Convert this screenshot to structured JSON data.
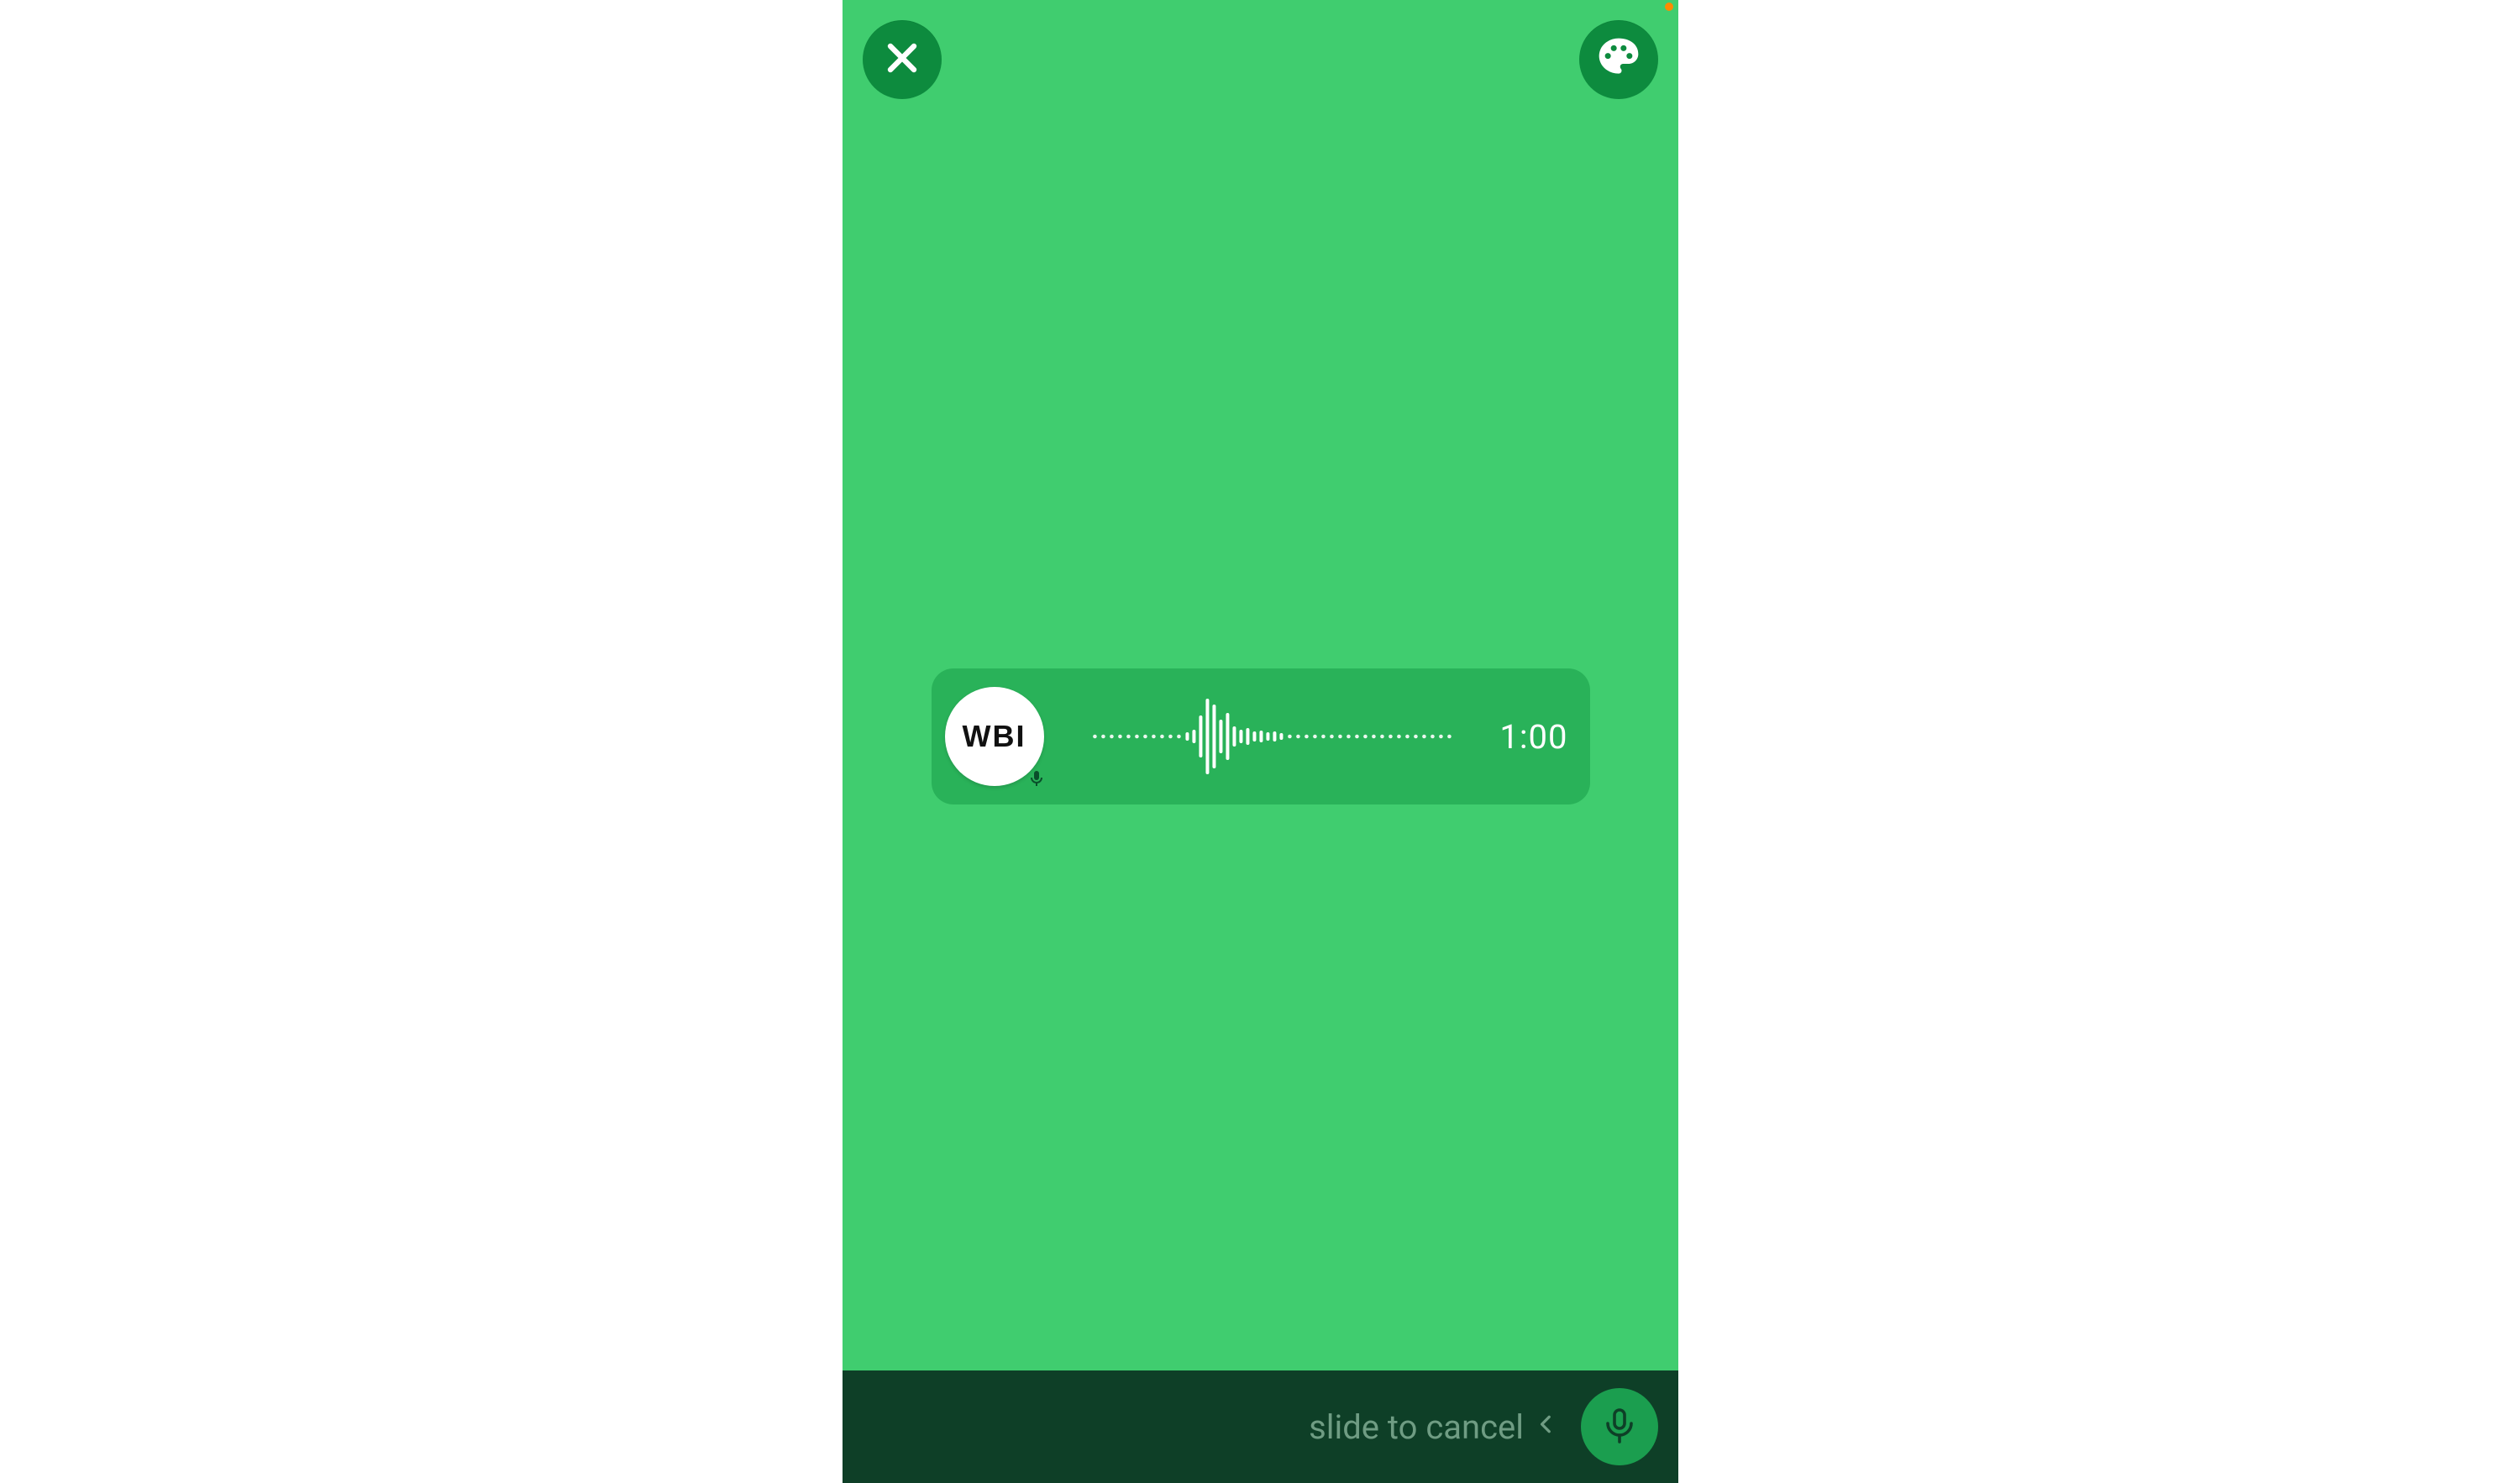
{
  "voice_card": {
    "avatar_label": "WBI",
    "duration": "1:00"
  },
  "bottom_bar": {
    "slide_to_cancel": "slide to cancel"
  },
  "colors": {
    "phone_bg": "#40cd6f",
    "top_btn_bg": "#0d8b3e",
    "voice_card_bg": "#29b259",
    "bottom_bar_bg": "#0e3f27",
    "mic_btn_bg": "#1b9e4f",
    "slide_text": "#6f9c83",
    "white": "#ffffff"
  },
  "icons": {
    "close": "close-icon",
    "palette": "palette-icon",
    "mic": "microphone-icon",
    "chevron_left": "chevron-left-icon"
  }
}
